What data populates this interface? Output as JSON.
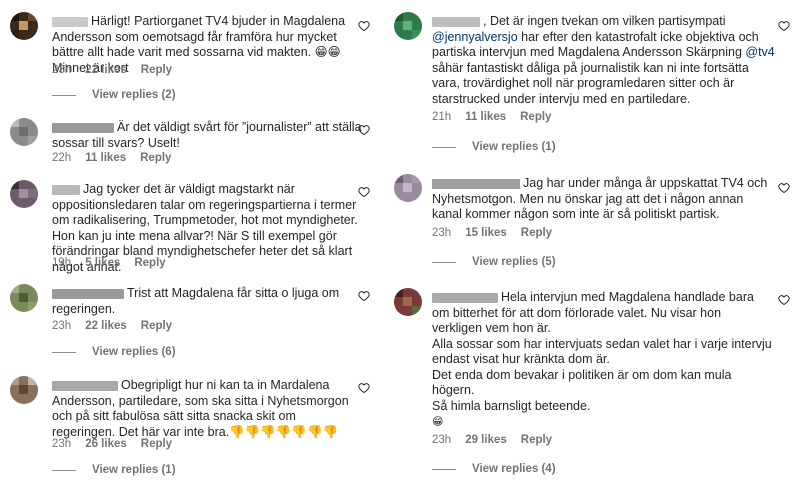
{
  "colors": {
    "text": "#262626",
    "meta": "#737373",
    "mention": "#00376b",
    "bg": "#ffffff"
  },
  "left": [
    {
      "text": "Härligt! Partiorganet TV4 bjuder in Magdalena Andersson som oemotsagd får framföra hur mycket bättre allt hade varit med sossarna vid makten. 😁😁 Minnet är kort",
      "time": "23h",
      "likes": "22 likes",
      "reply": "Reply",
      "view_replies": "View replies (2)"
    },
    {
      "text": "Är det väldigt svårt för ”journalister” att ställa sossar till svars? Uselt!",
      "time": "22h",
      "likes": "11 likes",
      "reply": "Reply"
    },
    {
      "text": "Jag tycker det är väldigt magstarkt när oppositionsledaren talar om regeringspartierna i termer om radikalisering, Trumpmetoder, hot mot myndigheter. Hon kan ju inte mena allvar?! När S till exempel gör förändringar bland myndighetschefer heter det så klart något annat.",
      "time": "19h",
      "likes": "5 likes",
      "reply": "Reply"
    },
    {
      "text": "Trist att Magdalena får sitta o ljuga om regeringen.",
      "time": "23h",
      "likes": "22 likes",
      "reply": "Reply",
      "view_replies": "View replies (6)"
    },
    {
      "text": "Obegripligt hur ni kan ta in Mardalena Andersson, partiledare, som ska sitta i Nyhetsmorgon och på sitt fabulösa sätt sitta snacka skit om regeringen. Det här var inte bra.👎👎👎👎👎👎👎",
      "time": "23h",
      "likes": "26 likes",
      "reply": "Reply",
      "view_replies": "View replies (1)"
    }
  ],
  "right": [
    {
      "text_pre": ", Det är ingen tvekan om vilken partisympati ",
      "mention1": "@jennyalversjo",
      "text_mid": " har efter den katastrofalt icke objektiva och partiska intervjun med Magdalena Andersson Skärpning ",
      "mention2": "@tv4",
      "text_post": " såhär fantastiskt dåliga på journalistik kan ni inte fortsätta vara, trovärdighet noll när programledaren sitter och är starstrucked under intervju med en partiledare.",
      "time": "21h",
      "likes": "11 likes",
      "reply": "Reply",
      "view_replies": "View replies (1)"
    },
    {
      "text": "Jag har under många år uppskattat TV4 och Nyhetsmotgon. Men nu önskar jag att det i någon annan kanal kommer någon som inte är så politiskt partisk.",
      "time": "23h",
      "likes": "15 likes",
      "reply": "Reply",
      "view_replies": "View replies (5)"
    },
    {
      "line1": "Hela intervjun med Magdalena handlade bara om bitterhet för att dom förlorade valet. Nu visar hon verkligen vem hon är.",
      "line2": "Alla sossar som har intervjuats sedan valet har i varje intervju endast visat hur kränkta dom är.",
      "line3": "Det enda dom bevakar i politiken är om dom kan mula högern.",
      "line4": "Så himla barnsligt beteende.",
      "emoji": "😁",
      "time": "23h",
      "likes": "29 likes",
      "reply": "Reply",
      "view_replies": "View replies (4)"
    }
  ],
  "icons": {
    "like": "heart-outline-icon"
  }
}
